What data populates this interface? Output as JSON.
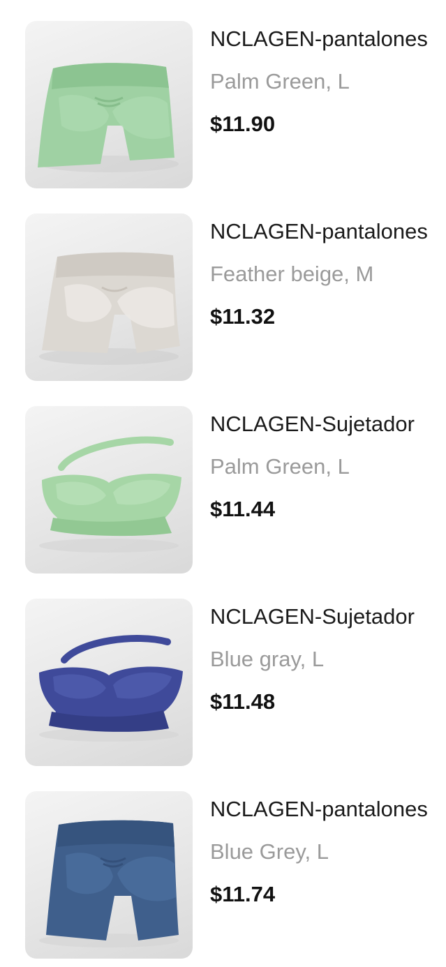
{
  "cart_items": [
    {
      "title": "NCLAGEN-pantalones",
      "variant": "Palm Green, L",
      "price": "$11.90",
      "image_icon": "shorts-icon",
      "product_color": "#9fd1a3"
    },
    {
      "title": "NCLAGEN-pantalones",
      "variant": "Feather beige, M",
      "price": "$11.32",
      "image_icon": "shorts-icon",
      "product_color": "#dcd8d2"
    },
    {
      "title": "NCLAGEN-Sujetador",
      "variant": "Palm Green, L",
      "price": "$11.44",
      "image_icon": "sports-bra-icon",
      "product_color": "#a6d6a6"
    },
    {
      "title": "NCLAGEN-Sujetador",
      "variant": "Blue gray, L",
      "price": "$11.48",
      "image_icon": "sports-bra-icon",
      "product_color": "#3f4a9a"
    },
    {
      "title": "NCLAGEN-pantalones",
      "variant": "Blue Grey, L",
      "price": "$11.74",
      "image_icon": "shorts-icon",
      "product_color": "#3f5f8c"
    }
  ]
}
